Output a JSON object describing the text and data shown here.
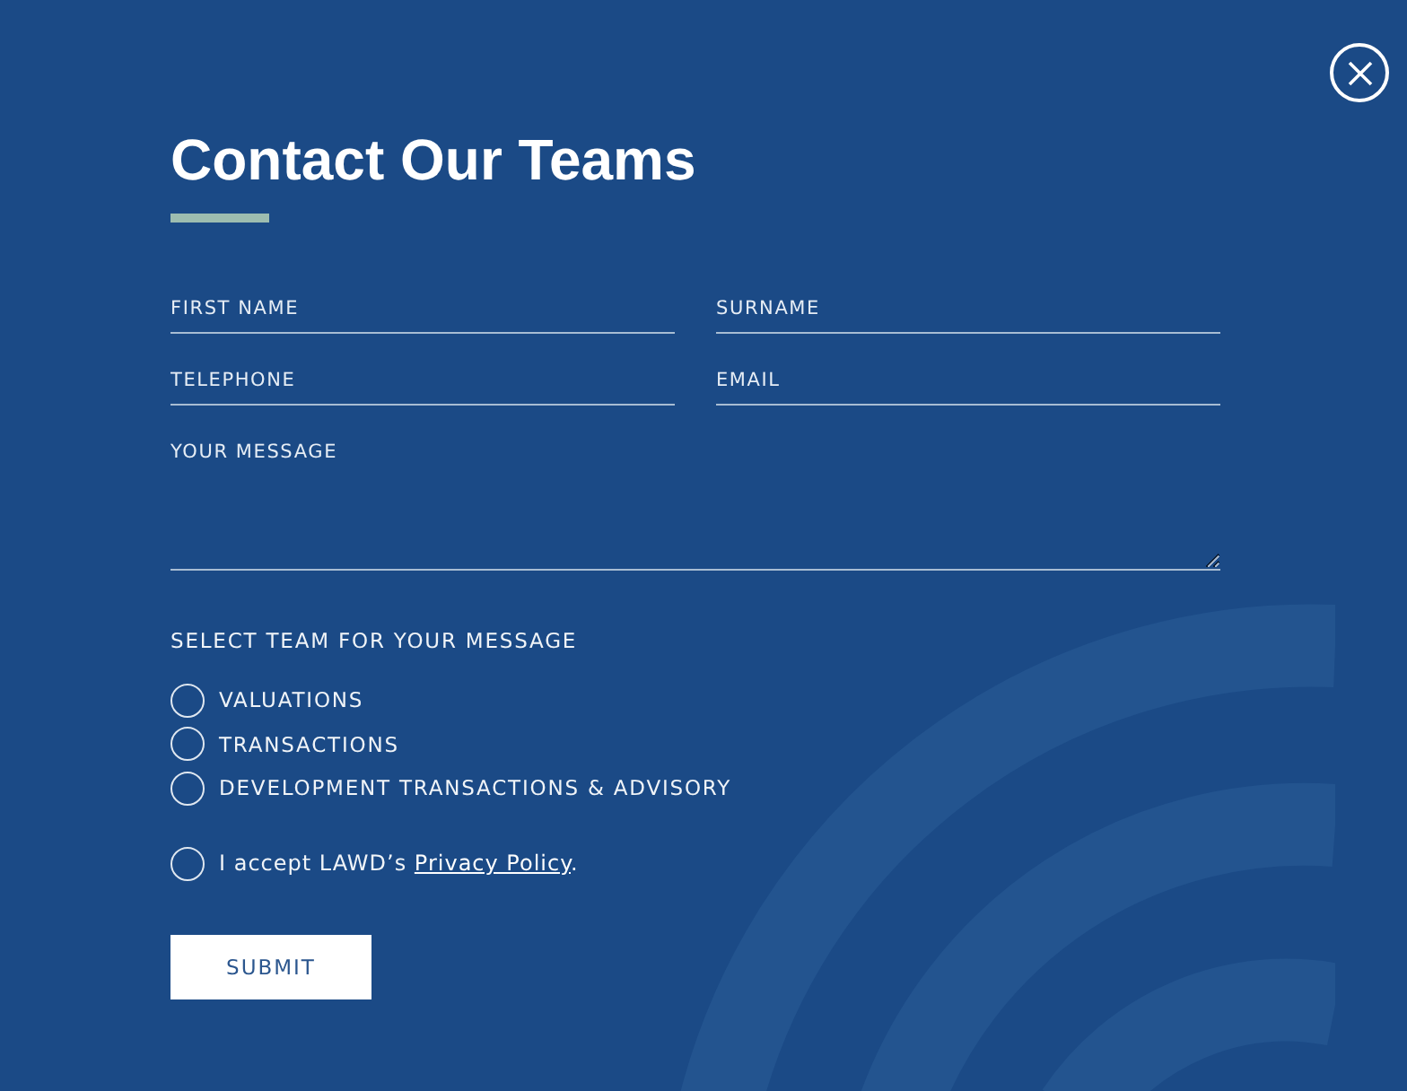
{
  "title": "Contact Our Teams",
  "fields": [
    {
      "placeholder": "FIRST NAME",
      "kind": "line"
    },
    {
      "placeholder": "SURNAME",
      "kind": "line"
    },
    {
      "placeholder": "TELEPHONE",
      "kind": "line"
    },
    {
      "placeholder": "EMAIL",
      "kind": "line"
    },
    {
      "placeholder": "YOUR MESSAGE",
      "kind": "area"
    }
  ],
  "team_prompt": "SELECT TEAM FOR YOUR MESSAGE",
  "teams": [
    {
      "label": "VALUATIONS",
      "selected": false
    },
    {
      "label": "TRANSACTIONS",
      "selected": false
    },
    {
      "label": "DEVELOPMENT TRANSACTIONS & ADVISORY",
      "selected": false
    }
  ],
  "consent": {
    "text": "I accept LAWD’s ",
    "link": "Privacy Policy",
    "suffix": ".",
    "checked": false
  },
  "submit": "SUBMIT"
}
